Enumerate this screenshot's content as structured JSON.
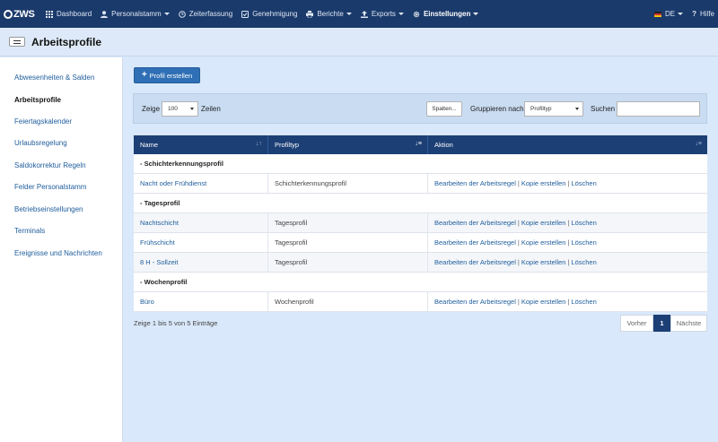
{
  "navbar": {
    "logo": "ZWS",
    "items": [
      {
        "label": "Dashboard",
        "icon": "grid-icon",
        "caret": false
      },
      {
        "label": "Personalstamm",
        "icon": "user-icon",
        "caret": true
      },
      {
        "label": "Zeiterfassung",
        "icon": "clock-icon",
        "caret": false
      },
      {
        "label": "Genehmigung",
        "icon": "check-square-icon",
        "caret": false
      },
      {
        "label": "Berichte",
        "icon": "print-icon",
        "caret": true
      },
      {
        "label": "Exports",
        "icon": "export-icon",
        "caret": true
      },
      {
        "label": "Einstellungen",
        "icon": "gear-icon",
        "caret": true
      }
    ],
    "language": "DE",
    "help": "Hilfe"
  },
  "header": {
    "title": "Arbeitsprofile"
  },
  "sidebar": {
    "items": [
      {
        "label": "Abwesenheiten & Salden",
        "active": false
      },
      {
        "label": "Arbeitsprofile",
        "active": true
      },
      {
        "label": "Feiertagskalender",
        "active": false
      },
      {
        "label": "Urlaubsregelung",
        "active": false
      },
      {
        "label": "Saldokorrektur Regeln",
        "active": false
      },
      {
        "label": "Felder Personalstamm",
        "active": false
      },
      {
        "label": "Betriebseinstellungen",
        "active": false
      },
      {
        "label": "Terminals",
        "active": false
      },
      {
        "label": "Ereignisse und Nachrichten",
        "active": false
      }
    ]
  },
  "toolbar": {
    "create_label": "Profil erstellen"
  },
  "filter": {
    "show_label": "Zeige",
    "page_size": "100",
    "rows_label": "Zeilen",
    "columns_button": "Spalten...",
    "group_label": "Gruppieren nach",
    "group_value": "Profiltyp",
    "search_label": "Suchen",
    "search_value": ""
  },
  "table": {
    "columns": [
      "Name",
      "Profiltyp",
      "Aktion"
    ],
    "actions": {
      "edit": "Bearbeiten der Arbeitsregel",
      "copy": "Kopie erstellen",
      "delete": "Löschen",
      "separator": "|"
    },
    "groups": [
      {
        "label": "- Schichterkennungsprofil",
        "rows": [
          {
            "name": "Nacht oder Frühdienst",
            "type": "Schichterkennungsprofil"
          }
        ]
      },
      {
        "label": "- Tagesprofil",
        "rows": [
          {
            "name": "Nachtschicht",
            "type": "Tagesprofil"
          },
          {
            "name": "Frühschicht",
            "type": "Tagesprofil"
          },
          {
            "name": "8 H - Sollzeit",
            "type": "Tagesprofil"
          }
        ]
      },
      {
        "label": "- Wochenprofil",
        "rows": [
          {
            "name": "Büro",
            "type": "Wochenprofil"
          }
        ]
      }
    ]
  },
  "footer": {
    "info": "Zeige 1 bis 5 von 5 Einträge",
    "prev": "Vorher",
    "current_page": "1",
    "next": "Nächste"
  }
}
